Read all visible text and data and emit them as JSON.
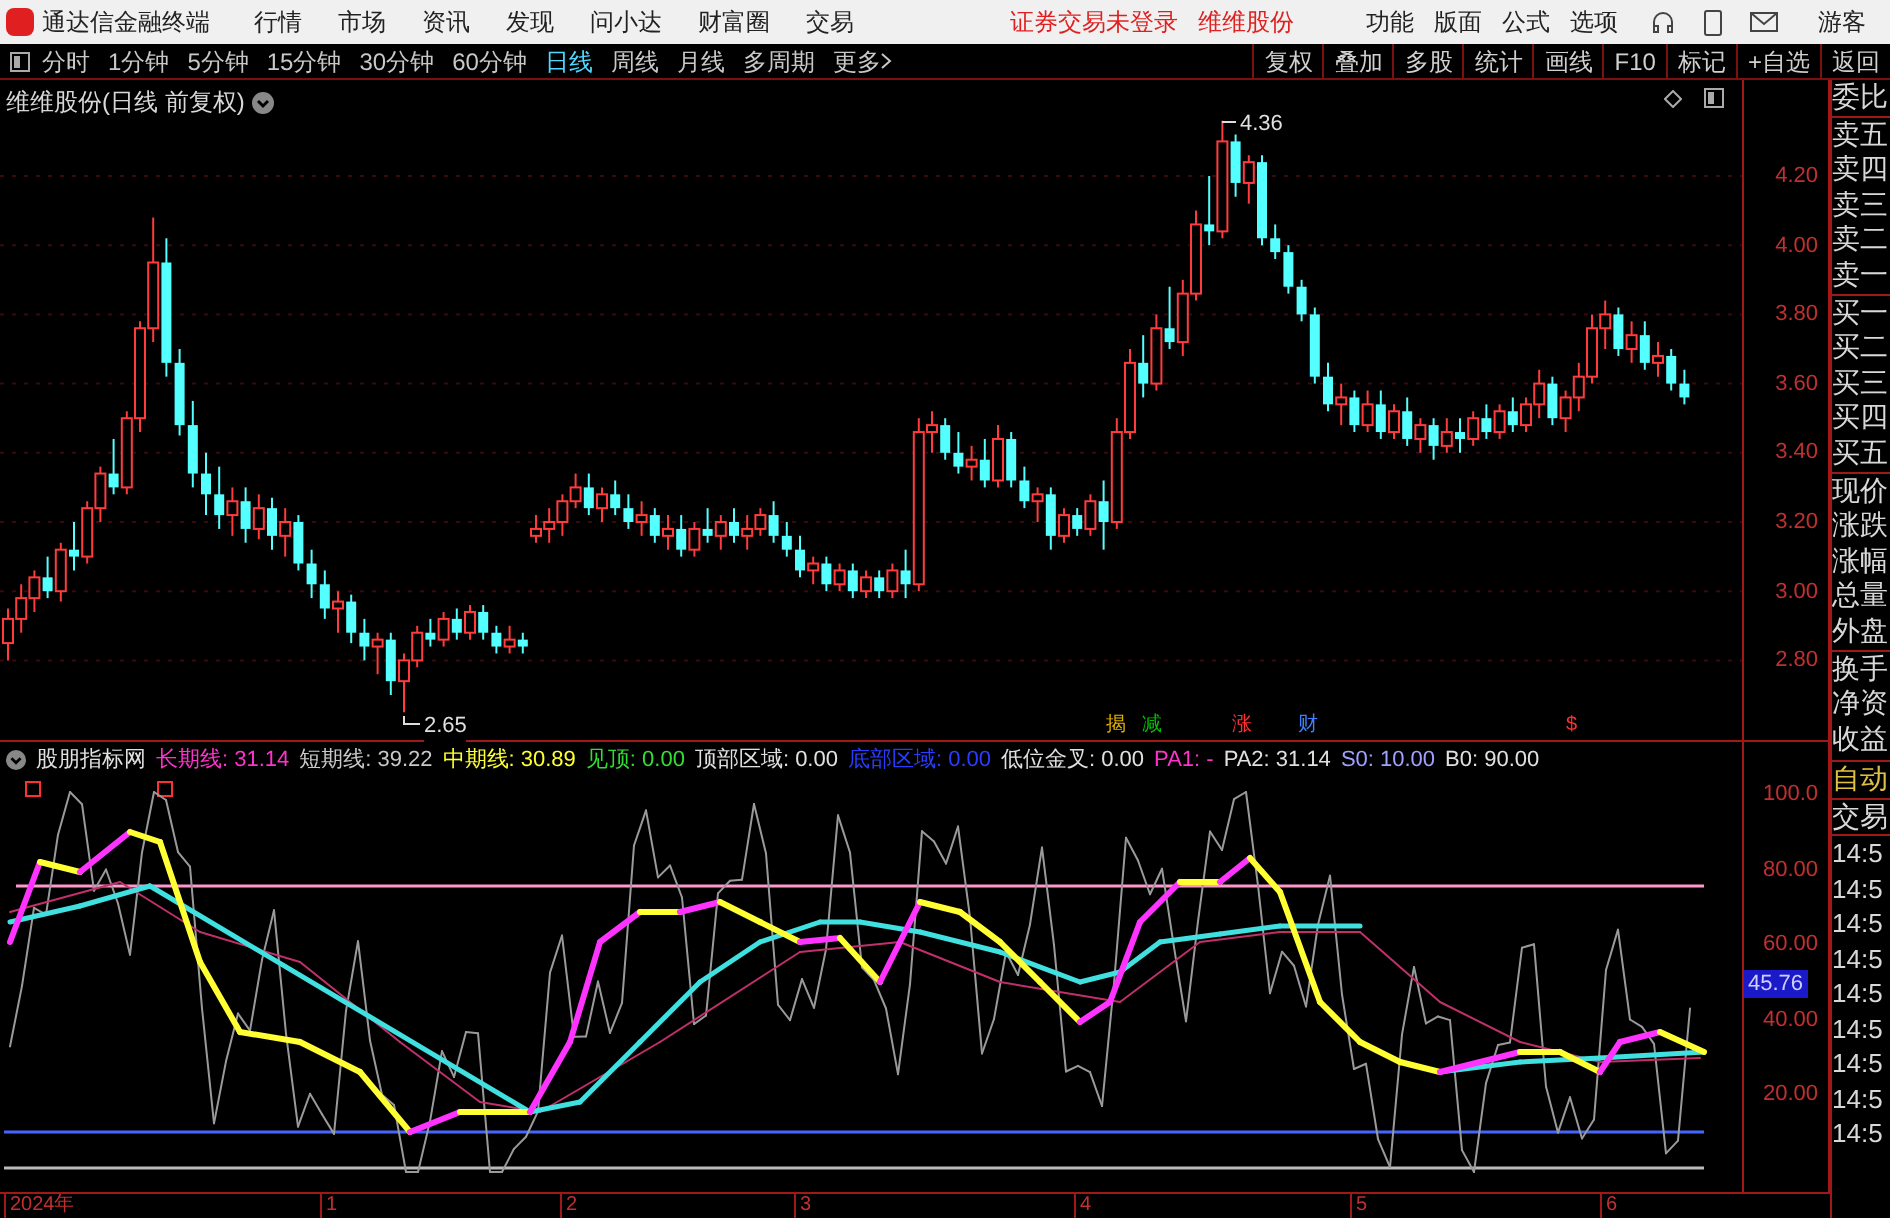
{
  "title_bar": {
    "app_name": "通达信金融终端",
    "menu": [
      "行情",
      "市场",
      "资讯",
      "发现",
      "问小达",
      "财富圈",
      "交易"
    ],
    "status": "证券交易未登录",
    "stock": "维维股份",
    "tools": [
      "功能",
      "版面",
      "公式",
      "选项"
    ],
    "user": "游客"
  },
  "period_bar": {
    "periods": [
      {
        "label": "分时",
        "selected": false
      },
      {
        "label": "1分钟",
        "selected": false
      },
      {
        "label": "5分钟",
        "selected": false
      },
      {
        "label": "15分钟",
        "selected": false
      },
      {
        "label": "30分钟",
        "selected": false
      },
      {
        "label": "60分钟",
        "selected": false
      },
      {
        "label": "日线",
        "selected": true
      },
      {
        "label": "周线",
        "selected": false
      },
      {
        "label": "月线",
        "selected": false
      },
      {
        "label": "多周期",
        "selected": false
      }
    ],
    "more": "更多",
    "actions": [
      "复权",
      "叠加",
      "多股",
      "统计",
      "画线",
      "F10",
      "标记",
      "+自选",
      "返回"
    ]
  },
  "main_chart": {
    "title": "维维股份(日线 前复权)",
    "chart_data": {
      "type": "candlestick",
      "ohlc": [
        [
          2.85,
          2.95,
          2.8,
          2.92
        ],
        [
          2.92,
          3.02,
          2.88,
          2.98
        ],
        [
          2.98,
          3.06,
          2.94,
          3.04
        ],
        [
          3.04,
          3.1,
          2.98,
          3.0
        ],
        [
          3.0,
          3.14,
          2.97,
          3.12
        ],
        [
          3.12,
          3.2,
          3.06,
          3.1
        ],
        [
          3.1,
          3.26,
          3.08,
          3.24
        ],
        [
          3.24,
          3.36,
          3.2,
          3.34
        ],
        [
          3.34,
          3.44,
          3.28,
          3.3
        ],
        [
          3.3,
          3.52,
          3.28,
          3.5
        ],
        [
          3.5,
          3.78,
          3.46,
          3.76
        ],
        [
          3.76,
          4.08,
          3.72,
          3.95
        ],
        [
          3.95,
          4.02,
          3.62,
          3.66
        ],
        [
          3.66,
          3.7,
          3.45,
          3.48
        ],
        [
          3.48,
          3.55,
          3.3,
          3.34
        ],
        [
          3.34,
          3.4,
          3.22,
          3.28
        ],
        [
          3.28,
          3.36,
          3.18,
          3.22
        ],
        [
          3.22,
          3.3,
          3.16,
          3.26
        ],
        [
          3.26,
          3.3,
          3.14,
          3.18
        ],
        [
          3.18,
          3.28,
          3.15,
          3.24
        ],
        [
          3.24,
          3.27,
          3.12,
          3.16
        ],
        [
          3.16,
          3.24,
          3.1,
          3.2
        ],
        [
          3.2,
          3.22,
          3.06,
          3.08
        ],
        [
          3.08,
          3.12,
          2.98,
          3.02
        ],
        [
          3.02,
          3.06,
          2.92,
          2.95
        ],
        [
          2.95,
          3.0,
          2.88,
          2.97
        ],
        [
          2.97,
          2.99,
          2.85,
          2.88
        ],
        [
          2.88,
          2.92,
          2.8,
          2.84
        ],
        [
          2.84,
          2.88,
          2.76,
          2.86
        ],
        [
          2.86,
          2.88,
          2.7,
          2.74
        ],
        [
          2.74,
          2.82,
          2.65,
          2.8
        ],
        [
          2.8,
          2.9,
          2.78,
          2.88
        ],
        [
          2.88,
          2.92,
          2.84,
          2.86
        ],
        [
          2.86,
          2.94,
          2.84,
          2.92
        ],
        [
          2.92,
          2.95,
          2.86,
          2.88
        ],
        [
          2.88,
          2.96,
          2.86,
          2.94
        ],
        [
          2.94,
          2.96,
          2.86,
          2.88
        ],
        [
          2.88,
          2.9,
          2.82,
          2.84
        ],
        [
          2.84,
          2.9,
          2.82,
          2.86
        ],
        [
          2.86,
          2.88,
          2.82,
          2.84
        ],
        [
          3.16,
          3.22,
          3.14,
          3.18
        ],
        [
          3.18,
          3.24,
          3.14,
          3.2
        ],
        [
          3.2,
          3.28,
          3.16,
          3.26
        ],
        [
          3.26,
          3.34,
          3.24,
          3.3
        ],
        [
          3.3,
          3.34,
          3.22,
          3.24
        ],
        [
          3.24,
          3.3,
          3.2,
          3.28
        ],
        [
          3.28,
          3.32,
          3.22,
          3.24
        ],
        [
          3.24,
          3.28,
          3.18,
          3.2
        ],
        [
          3.2,
          3.26,
          3.16,
          3.22
        ],
        [
          3.22,
          3.24,
          3.14,
          3.16
        ],
        [
          3.16,
          3.22,
          3.12,
          3.18
        ],
        [
          3.18,
          3.22,
          3.1,
          3.12
        ],
        [
          3.12,
          3.2,
          3.1,
          3.18
        ],
        [
          3.18,
          3.24,
          3.14,
          3.16
        ],
        [
          3.16,
          3.22,
          3.12,
          3.2
        ],
        [
          3.2,
          3.24,
          3.14,
          3.16
        ],
        [
          3.16,
          3.22,
          3.12,
          3.18
        ],
        [
          3.18,
          3.24,
          3.16,
          3.22
        ],
        [
          3.22,
          3.26,
          3.14,
          3.16
        ],
        [
          3.16,
          3.2,
          3.1,
          3.12
        ],
        [
          3.12,
          3.16,
          3.04,
          3.06
        ],
        [
          3.06,
          3.1,
          3.02,
          3.08
        ],
        [
          3.08,
          3.1,
          3.0,
          3.02
        ],
        [
          3.02,
          3.08,
          3.0,
          3.06
        ],
        [
          3.06,
          3.08,
          2.98,
          3.0
        ],
        [
          3.0,
          3.06,
          2.98,
          3.04
        ],
        [
          3.04,
          3.06,
          2.98,
          3.0
        ],
        [
          3.0,
          3.08,
          2.98,
          3.06
        ],
        [
          3.06,
          3.12,
          2.98,
          3.02
        ],
        [
          3.02,
          3.5,
          3.0,
          3.46
        ],
        [
          3.46,
          3.52,
          3.4,
          3.48
        ],
        [
          3.48,
          3.5,
          3.38,
          3.4
        ],
        [
          3.4,
          3.46,
          3.34,
          3.36
        ],
        [
          3.36,
          3.42,
          3.32,
          3.38
        ],
        [
          3.38,
          3.44,
          3.3,
          3.32
        ],
        [
          3.32,
          3.48,
          3.3,
          3.44
        ],
        [
          3.44,
          3.46,
          3.3,
          3.32
        ],
        [
          3.32,
          3.36,
          3.24,
          3.26
        ],
        [
          3.26,
          3.3,
          3.2,
          3.28
        ],
        [
          3.28,
          3.3,
          3.12,
          3.16
        ],
        [
          3.16,
          3.24,
          3.14,
          3.22
        ],
        [
          3.22,
          3.24,
          3.16,
          3.18
        ],
        [
          3.18,
          3.28,
          3.16,
          3.26
        ],
        [
          3.26,
          3.32,
          3.12,
          3.2
        ],
        [
          3.2,
          3.5,
          3.18,
          3.46
        ],
        [
          3.46,
          3.7,
          3.44,
          3.66
        ],
        [
          3.66,
          3.74,
          3.56,
          3.6
        ],
        [
          3.6,
          3.8,
          3.58,
          3.76
        ],
        [
          3.76,
          3.88,
          3.7,
          3.72
        ],
        [
          3.72,
          3.9,
          3.68,
          3.86
        ],
        [
          3.86,
          4.1,
          3.84,
          4.06
        ],
        [
          4.06,
          4.2,
          4.0,
          4.04
        ],
        [
          4.04,
          4.36,
          4.02,
          4.3
        ],
        [
          4.3,
          4.32,
          4.14,
          4.18
        ],
        [
          4.18,
          4.26,
          4.12,
          4.24
        ],
        [
          4.24,
          4.26,
          4.0,
          4.02
        ],
        [
          4.02,
          4.06,
          3.96,
          3.98
        ],
        [
          3.98,
          4.0,
          3.86,
          3.88
        ],
        [
          3.88,
          3.9,
          3.78,
          3.8
        ],
        [
          3.8,
          3.82,
          3.6,
          3.62
        ],
        [
          3.62,
          3.66,
          3.52,
          3.54
        ],
        [
          3.54,
          3.6,
          3.48,
          3.56
        ],
        [
          3.56,
          3.58,
          3.46,
          3.48
        ],
        [
          3.48,
          3.58,
          3.46,
          3.54
        ],
        [
          3.54,
          3.58,
          3.44,
          3.46
        ],
        [
          3.46,
          3.54,
          3.44,
          3.52
        ],
        [
          3.52,
          3.56,
          3.42,
          3.44
        ],
        [
          3.44,
          3.5,
          3.4,
          3.48
        ],
        [
          3.48,
          3.5,
          3.38,
          3.42
        ],
        [
          3.42,
          3.5,
          3.4,
          3.46
        ],
        [
          3.46,
          3.5,
          3.4,
          3.44
        ],
        [
          3.44,
          3.52,
          3.42,
          3.5
        ],
        [
          3.5,
          3.54,
          3.44,
          3.46
        ],
        [
          3.46,
          3.54,
          3.44,
          3.52
        ],
        [
          3.52,
          3.56,
          3.46,
          3.48
        ],
        [
          3.48,
          3.56,
          3.46,
          3.54
        ],
        [
          3.54,
          3.64,
          3.5,
          3.6
        ],
        [
          3.6,
          3.62,
          3.48,
          3.5
        ],
        [
          3.5,
          3.58,
          3.46,
          3.56
        ],
        [
          3.56,
          3.66,
          3.52,
          3.62
        ],
        [
          3.62,
          3.8,
          3.6,
          3.76
        ],
        [
          3.76,
          3.84,
          3.7,
          3.8
        ],
        [
          3.8,
          3.82,
          3.68,
          3.7
        ],
        [
          3.7,
          3.78,
          3.66,
          3.74
        ],
        [
          3.74,
          3.78,
          3.64,
          3.66
        ],
        [
          3.66,
          3.72,
          3.62,
          3.68
        ],
        [
          3.68,
          3.7,
          3.58,
          3.6
        ],
        [
          3.6,
          3.64,
          3.54,
          3.56
        ]
      ]
    },
    "high_label": "4.36",
    "low_label": "2.65",
    "event_marks": [
      {
        "label": "揭",
        "color": "#e0b000"
      },
      {
        "label": "减",
        "color": "#00c000"
      },
      {
        "label": "涨",
        "color": "#ff3030"
      },
      {
        "label": "财",
        "color": "#4080ff"
      },
      {
        "label": "$",
        "color": "#ff3030"
      }
    ],
    "y_axis": [
      "4.20",
      "4.00",
      "3.80",
      "3.60",
      "3.40",
      "3.20",
      "3.00",
      "2.80"
    ]
  },
  "indicator": {
    "name": "股朋指标网",
    "readings": [
      {
        "text": "长期线: 31.14",
        "color": "#ff33cc"
      },
      {
        "text": "短期线: 39.22",
        "color": "#c8c8c8"
      },
      {
        "text": "中期线: 30.89",
        "color": "#ffff33"
      },
      {
        "text": "见顶: 0.00",
        "color": "#33dd33"
      },
      {
        "text": "顶部区域: 0.00",
        "color": "#e0e0e0"
      },
      {
        "text": "底部区域: 0.00",
        "color": "#2a3cff"
      },
      {
        "text": "低位金叉: 0.00",
        "color": "#e0e0e0"
      },
      {
        "text": "PA1: -",
        "color": "#ff33cc"
      },
      {
        "text": "PA2: 31.14",
        "color": "#e0e0e0"
      },
      {
        "text": "S0: 10.00",
        "color": "#a0a0ff"
      },
      {
        "text": "B0: 90.00",
        "color": "#e0e0e0"
      }
    ],
    "y_axis": [
      "100.0",
      "80.00",
      "60.00",
      "40.00",
      "20.00"
    ],
    "current_value": "45.76"
  },
  "x_axis": [
    "2024年",
    "1",
    "2",
    "3",
    "4",
    "5",
    "6"
  ],
  "quote_panel": {
    "labels": [
      "委比",
      "卖五",
      "卖四",
      "卖三",
      "卖二",
      "卖一",
      "买一",
      "买二",
      "买三",
      "买四",
      "买五",
      "现价",
      "涨跌",
      "涨幅",
      "总量",
      "外盘",
      "换手",
      "净资",
      "收益"
    ],
    "trade_tabs": [
      "自动",
      "交易"
    ],
    "times": [
      "14:5",
      "14:5",
      "14:5",
      "14:5",
      "14:5",
      "14:5",
      "14:5",
      "14:5",
      "14:5"
    ]
  }
}
